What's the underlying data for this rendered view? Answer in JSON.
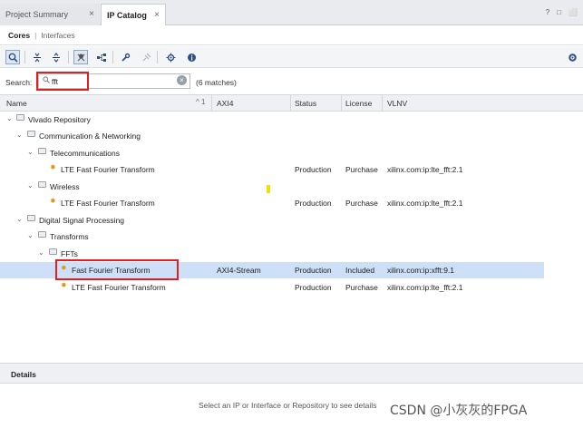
{
  "tabs": [
    {
      "label": "Project Summary",
      "active": false
    },
    {
      "label": "IP Catalog",
      "active": true
    }
  ],
  "tabbar_icons": [
    "help-icon",
    "restore-icon",
    "maximize-icon"
  ],
  "tabbar_glyphs": {
    "help": "?",
    "restore": "□",
    "maximize": "⬜"
  },
  "subtabs": {
    "active": "Cores",
    "separator": "|",
    "inactive": "Interfaces"
  },
  "toolbar": {
    "buttons": [
      "search-icon",
      "collapse-all-icon",
      "expand-all-icon",
      "filter-icon",
      "hierarchy-icon",
      "wrench-icon",
      "pin-icon",
      "chip-settings-icon",
      "info-icon",
      "gear-icon"
    ]
  },
  "search": {
    "label": "Search:",
    "value": "fft",
    "matches": "(6 matches)"
  },
  "table": {
    "columns": [
      "Name",
      "AXI4",
      "Status",
      "License",
      "VLNV"
    ],
    "sort_indicator": "^ 1"
  },
  "tree": [
    {
      "depth": 0,
      "type": "folder",
      "name": "Vivado Repository"
    },
    {
      "depth": 1,
      "type": "folder",
      "name": "Communication & Networking"
    },
    {
      "depth": 2,
      "type": "folder",
      "name": "Telecommunications"
    },
    {
      "depth": 3,
      "type": "ip",
      "name": "LTE Fast Fourier Transform",
      "axi": "",
      "status": "Production",
      "license": "Purchase",
      "vlnv": "xilinx.com:ip:lte_fft:2.1"
    },
    {
      "depth": 2,
      "type": "folder",
      "name": "Wireless"
    },
    {
      "depth": 3,
      "type": "ip",
      "name": "LTE Fast Fourier Transform",
      "axi": "",
      "status": "Production",
      "license": "Purchase",
      "vlnv": "xilinx.com:ip:lte_fft:2.1"
    },
    {
      "depth": 1,
      "type": "folder",
      "name": "Digital Signal Processing"
    },
    {
      "depth": 2,
      "type": "folder",
      "name": "Transforms"
    },
    {
      "depth": 3,
      "type": "folder",
      "name": "FFTs"
    },
    {
      "depth": 4,
      "type": "ip",
      "name": "Fast Fourier Transform",
      "axi": "AXI4-Stream",
      "status": "Production",
      "license": "Included",
      "vlnv": "xilinx.com:ip:xfft:9.1",
      "selected": true
    },
    {
      "depth": 4,
      "type": "ip",
      "name": "LTE Fast Fourier Transform",
      "axi": "",
      "status": "Production",
      "license": "Purchase",
      "vlnv": "xilinx.com:ip:lte_fft:2.1"
    }
  ],
  "details": {
    "title": "Details",
    "message": "Select an IP or Interface or Repository to see details"
  },
  "watermark": "CSDN @小灰灰的FPGA",
  "colors": {
    "selection": "#cde0f7",
    "highlight": "#e02020",
    "ip_icon": "#d89a1a"
  }
}
